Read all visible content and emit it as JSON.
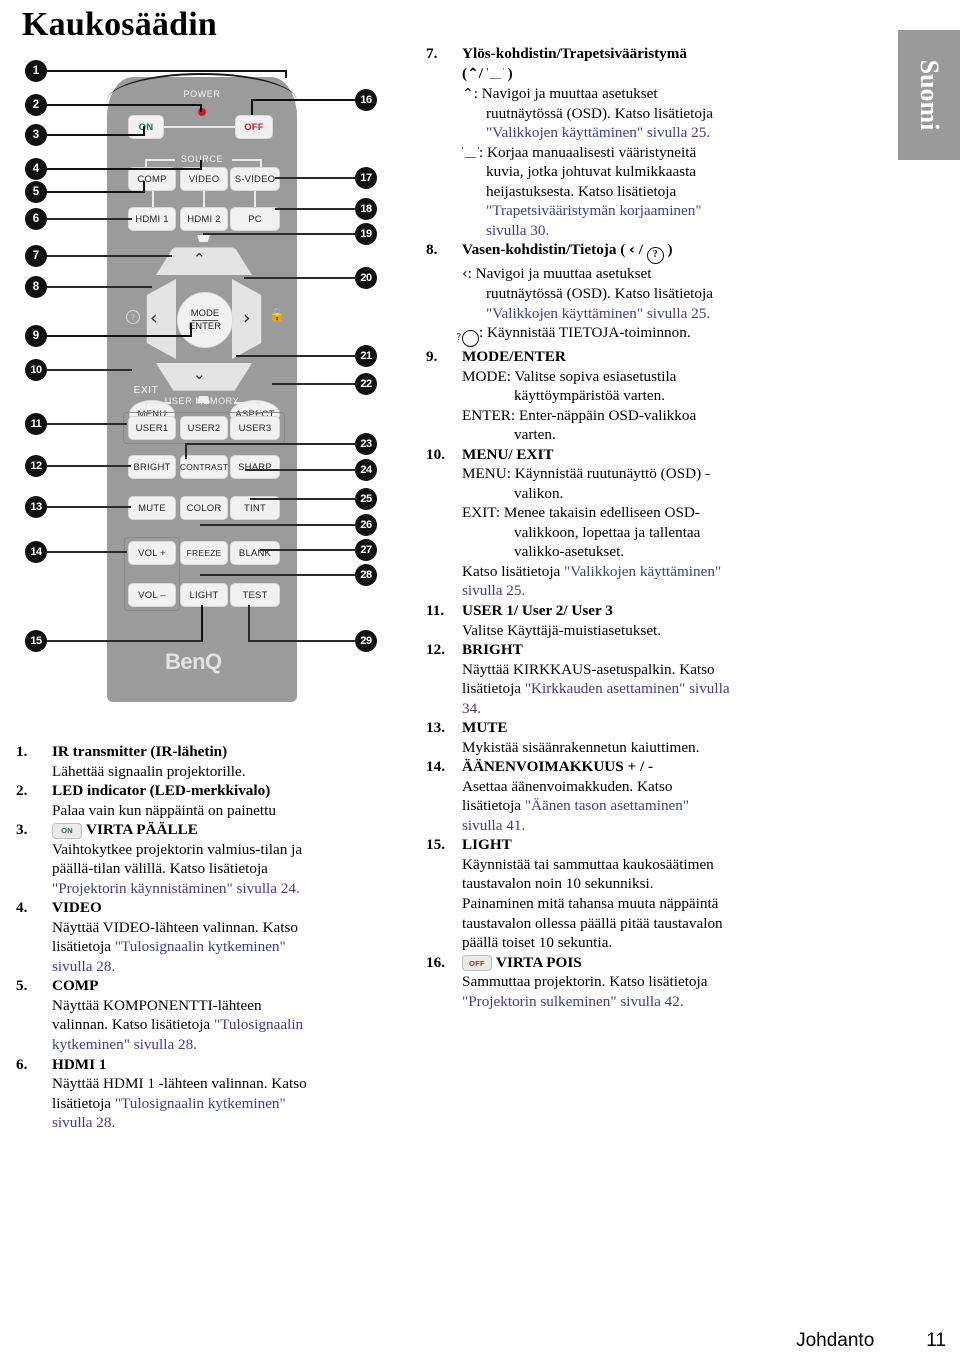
{
  "page": {
    "title": "Kaukosäädin",
    "language_tab": "Suomi",
    "footer": {
      "section": "Johdanto",
      "page_number": "11"
    }
  },
  "remote": {
    "labels": {
      "power": "POWER",
      "source": "SOURCE",
      "user_memory": "USER MEMORY",
      "exit": "EXIT",
      "brand": "BenQ"
    },
    "buttons": {
      "on": "ON",
      "off": "OFF",
      "comp": "COMP",
      "video": "VIDEO",
      "svideo": "S-VIDEO",
      "hdmi1": "HDMI 1",
      "hdmi2": "HDMI 2",
      "pc": "PC",
      "mode": "MODE",
      "enter": "ENTER",
      "menu": "MENU",
      "aspect": "ASPECT",
      "user1": "USER1",
      "user2": "USER2",
      "user3": "USER3",
      "bright": "BRIGHT",
      "contrast": "CONTRAST",
      "sharp": "SHARP",
      "mute": "MUTE",
      "color": "COLOR",
      "tint": "TINT",
      "volplus": "VOL +",
      "freeze": "FREEZE",
      "blank": "BLANK",
      "volminus": "VOL –",
      "light": "LIGHT",
      "test": "TEST",
      "up": "⌃",
      "down": "⌄",
      "left": "‹",
      "right": "›"
    },
    "callouts_left": [
      "1",
      "2",
      "3",
      "4",
      "5",
      "6",
      "7",
      "8",
      "9",
      "10",
      "11",
      "12",
      "13",
      "14",
      "15"
    ],
    "callouts_right": [
      "16",
      "17",
      "18",
      "19",
      "20",
      "21",
      "22",
      "23",
      "24",
      "25",
      "26",
      "27",
      "28",
      "29"
    ]
  },
  "left_column": [
    {
      "num": "1.",
      "heading": "IR transmitter (IR-lähetin)",
      "lines": [
        {
          "text": "Lähettää signaalin projektorille."
        }
      ]
    },
    {
      "num": "2.",
      "heading": "LED indicator (LED-merkkivalo)",
      "lines": [
        {
          "text": "Palaa vain kun näppäintä on painettu"
        }
      ]
    },
    {
      "num": "3.",
      "keycap": "ON",
      "heading": "VIRTA PÄÄLLE",
      "lines": [
        {
          "text": "Vaihtokytkee projektorin valmius-tilan ja"
        },
        {
          "text": "päällä-tilan välillä. Katso lisätietoja"
        },
        {
          "text": "\"Projektorin käynnistäminen\" sivulla 24.",
          "link": true
        }
      ]
    },
    {
      "num": "4.",
      "heading": "VIDEO",
      "lines": [
        {
          "text": "Näyttää VIDEO-lähteen valinnan. Katso"
        },
        {
          "text": "lisätietoja ",
          "link_tail": "\"Tulosignaalin kytkeminen\""
        },
        {
          "text": "sivulla 28.",
          "link": true
        }
      ]
    },
    {
      "num": "5.",
      "heading": "COMP",
      "lines": [
        {
          "text": "Näyttää KOMPONENTTI-lähteen"
        },
        {
          "text": "valinnan. Katso lisätietoja ",
          "link_tail": "\"Tulosignaalin"
        },
        {
          "text": "kytkeminen\" sivulla 28.",
          "link": true
        }
      ]
    },
    {
      "num": "6.",
      "heading": "HDMI 1",
      "lines": [
        {
          "text": "Näyttää HDMI 1 -lähteen valinnan. Katso"
        },
        {
          "text": "lisätietoja ",
          "link_tail": "\"Tulosignaalin kytkeminen\""
        },
        {
          "text": "sivulla 28.",
          "link": true
        }
      ]
    }
  ],
  "right_column": [
    {
      "num": "7.",
      "heading": "Ylös-kohdistin/Trapetsivääristymä",
      "subheading_symbols": "( ⌃ / ▱ )",
      "blocks": [
        {
          "bullet": "up-arrow",
          "lines": [
            ": Navigoi ja muuttaa asetukset",
            "ruutnäytössä (OSD). Katso lisätietoja"
          ],
          "link_line": "\"Valikkojen käyttäminen\" sivulla 25."
        },
        {
          "bullet": "trapezoid",
          "lines": [
            ": Korjaa manuaalisesti vääristyneitä",
            "kuvia, jotka johtuvat kulmikkaasta",
            "heijastuksesta. Katso lisätietoja"
          ],
          "link_line": "\"Trapetsivääristymän korjaaminen\"",
          "link_line2": "sivulla 30."
        }
      ]
    },
    {
      "num": "8.",
      "heading": "Vasen-kohdistin/Tietoja ( ‹ / ? )",
      "blocks": [
        {
          "bullet": "left-arrow",
          "lines": [
            ": Navigoi ja muuttaa asetukset",
            "ruutnäytössä (OSD). Katso lisätietoja"
          ],
          "link_line": "\"Valikkojen käyttäminen\" sivulla 25."
        },
        {
          "bullet": "question",
          "lines": [
            ": Käynnistää TIETOJA-toiminnon."
          ]
        }
      ]
    },
    {
      "num": "9.",
      "heading": "MODE/ENTER",
      "lines": [
        "MODE: Valitse sopiva esiasetustila",
        "käyttöympäristöä varten.",
        "ENTER: Enter-näppäin OSD-valikkoa",
        "varten."
      ]
    },
    {
      "num": "10.",
      "heading": "MENU/ EXIT",
      "lines": [
        "MENU: Käynnistää ruutunäyttö (OSD) -",
        "valikon.",
        "EXIT: Menee takaisin edelliseen OSD-",
        "valikkoon, lopettaa ja tallentaa",
        "valikko-asetukset."
      ],
      "tail": "Katso lisätietoja ",
      "tail_link": "\"Valikkojen käyttäminen\"",
      "tail_link2": "sivulla 25."
    },
    {
      "num": "11.",
      "heading": "USER 1/ User 2/ User 3",
      "lines": [
        "Valitse Käyttäjä-muistiasetukset."
      ]
    },
    {
      "num": "12.",
      "heading": "BRIGHT",
      "lines": [
        "Näyttää KIRKKAUS-asetuspalkin. Katso"
      ],
      "tail": "lisätietoja ",
      "tail_link": "\"Kirkkauden asettaminen\" sivulla",
      "tail_link2": "34."
    },
    {
      "num": "13.",
      "heading": "MUTE",
      "lines": [
        "Mykistää sisäänrakennetun kaiuttimen."
      ]
    },
    {
      "num": "14.",
      "heading": "ÄÄNENVOIMAKKUUS + / -",
      "lines": [
        "Asettaa äänenvoimakkuden. Katso"
      ],
      "tail": "lisätietoja ",
      "tail_link": "\"Äänen tason asettaminen\"",
      "tail_link2": "sivulla 41."
    },
    {
      "num": "15.",
      "heading": "LIGHT",
      "lines": [
        "Käynnistää tai sammuttaa kaukosäätimen",
        "taustavalon noin 10 sekunniksi.",
        "Painaminen mitä tahansa muuta näppäintä",
        "taustavalon ollessa päällä pitää taustavalon",
        "päällä toiset 10 sekuntia."
      ]
    },
    {
      "num": "16.",
      "keycap": "OFF",
      "heading": "VIRTA POIS",
      "lines": [
        "Sammuttaa projektorin. Katso lisätietoja"
      ],
      "tail_link": "\"Projektorin sulkeminen\" sivulla 42."
    }
  ]
}
